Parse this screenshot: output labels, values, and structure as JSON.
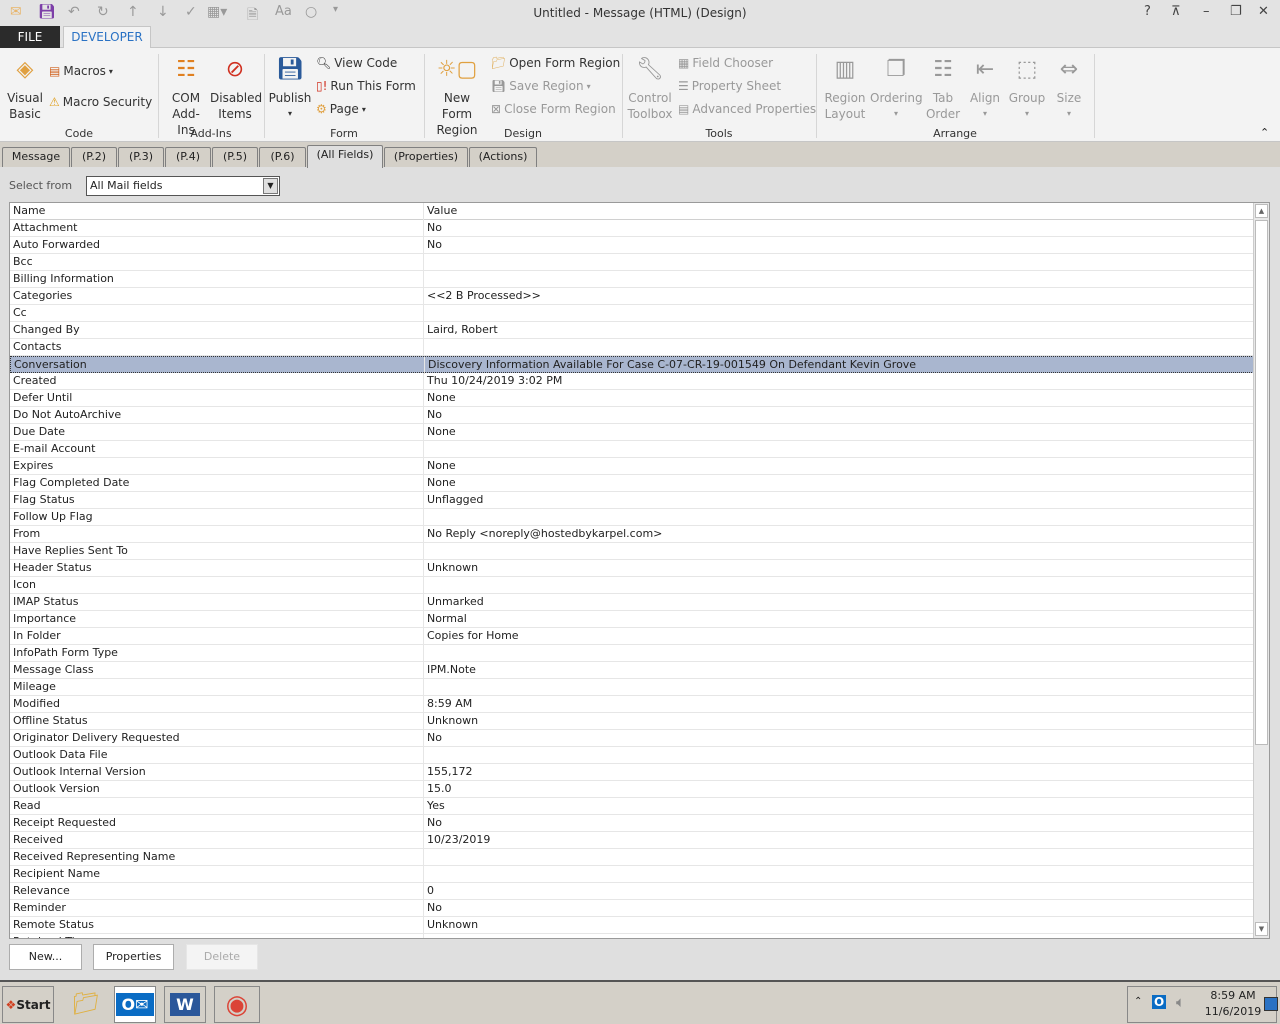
{
  "window": {
    "title": "Untitled - Message (HTML)  (Design)",
    "help": "?",
    "restore_ribbon": "⊼",
    "minimize": "–",
    "maximize": "❐",
    "close": "✕"
  },
  "ribbon_tabs": {
    "file": "FILE",
    "developer": "DEVELOPER"
  },
  "ribbon": {
    "code": {
      "label": "Code",
      "visual_basic": [
        "Visual",
        "Basic"
      ],
      "macros": "Macros",
      "macro_security": "Macro Security"
    },
    "addins": {
      "label": "Add-Ins",
      "com": [
        "COM",
        "Add-Ins"
      ],
      "disabled": [
        "Disabled",
        "Items"
      ]
    },
    "form": {
      "label": "Form",
      "publish": "Publish",
      "view_code": "View Code",
      "run_form": "Run This Form",
      "page": "Page"
    },
    "design": {
      "label": "Design",
      "new_region": [
        "New Form",
        "Region"
      ],
      "open_region": "Open Form Region",
      "save_region": "Save Region",
      "close_region": "Close Form Region"
    },
    "tools": {
      "label": "Tools",
      "control_toolbox": [
        "Control",
        "Toolbox"
      ],
      "field_chooser": "Field Chooser",
      "property_sheet": "Property Sheet",
      "advanced_properties": "Advanced Properties"
    },
    "arrange": {
      "label": "Arrange",
      "region_layout": [
        "Region",
        "Layout"
      ],
      "ordering": "Ordering",
      "tab_order": [
        "Tab",
        "Order"
      ],
      "align": "Align",
      "group": "Group",
      "size": "Size"
    }
  },
  "form_tabs": [
    "Message",
    "(P.2)",
    "(P.3)",
    "(P.4)",
    "(P.5)",
    "(P.6)",
    "(All Fields)",
    "(Properties)",
    "(Actions)"
  ],
  "active_form_tab": "(All Fields)",
  "select_from": {
    "label": "Select from",
    "value": "All Mail fields"
  },
  "grid": {
    "columns": [
      "Name",
      "Value"
    ],
    "selected": "Conversation",
    "rows": [
      [
        "Attachment",
        "No"
      ],
      [
        "Auto Forwarded",
        "No"
      ],
      [
        "Bcc",
        ""
      ],
      [
        "Billing Information",
        ""
      ],
      [
        "Categories",
        "<<2 B Processed>>"
      ],
      [
        "Cc",
        ""
      ],
      [
        "Changed By",
        "Laird, Robert"
      ],
      [
        "Contacts",
        ""
      ],
      [
        "Conversation",
        "Discovery Information Available For Case C-07-CR-19-001549 On Defendant Kevin Grove"
      ],
      [
        "Created",
        "Thu 10/24/2019 3:02 PM"
      ],
      [
        "Defer Until",
        "None"
      ],
      [
        "Do Not AutoArchive",
        "No"
      ],
      [
        "Due Date",
        "None"
      ],
      [
        "E-mail Account",
        ""
      ],
      [
        "Expires",
        "None"
      ],
      [
        "Flag Completed Date",
        "None"
      ],
      [
        "Flag Status",
        "Unflagged"
      ],
      [
        "Follow Up Flag",
        ""
      ],
      [
        "From",
        "No Reply <noreply@hostedbykarpel.com>"
      ],
      [
        "Have Replies Sent To",
        ""
      ],
      [
        "Header Status",
        "Unknown"
      ],
      [
        "Icon",
        ""
      ],
      [
        "IMAP Status",
        "Unmarked"
      ],
      [
        "Importance",
        "Normal"
      ],
      [
        "In Folder",
        "Copies for Home"
      ],
      [
        "InfoPath Form Type",
        ""
      ],
      [
        "Message Class",
        "IPM.Note"
      ],
      [
        "Mileage",
        ""
      ],
      [
        "Modified",
        "8:59 AM"
      ],
      [
        "Offline Status",
        "Unknown"
      ],
      [
        "Originator Delivery Requested",
        "No"
      ],
      [
        "Outlook Data File",
        ""
      ],
      [
        "Outlook Internal Version",
        "155,172"
      ],
      [
        "Outlook Version",
        "15.0"
      ],
      [
        "Read",
        "Yes"
      ],
      [
        "Receipt Requested",
        "No"
      ],
      [
        "Received",
        "10/23/2019"
      ],
      [
        "Received Representing Name",
        ""
      ],
      [
        "Recipient Name",
        ""
      ],
      [
        "Relevance",
        "0"
      ],
      [
        "Reminder",
        "No"
      ],
      [
        "Remote Status",
        "Unknown"
      ],
      [
        "Retained Time",
        ""
      ]
    ]
  },
  "buttons": {
    "new": "New...",
    "properties": "Properties",
    "delete": "Delete"
  },
  "taskbar": {
    "start": "Start",
    "time": "8:59 AM",
    "date": "11/6/2019"
  },
  "colors": {
    "selected_row": "#a9b6cf",
    "developer_tab": "#2a72c4"
  }
}
